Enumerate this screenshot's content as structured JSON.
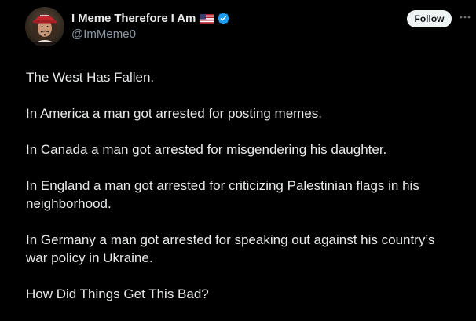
{
  "author": {
    "display_name": "I Meme Therefore I Am",
    "handle": "@ImMeme0",
    "flag_icon": "us-flag-icon",
    "verified_icon": "verified-badge-icon",
    "verified_color": "#1d9bf0"
  },
  "actions": {
    "follow_label": "Follow",
    "more_icon": "more-horizontal-icon"
  },
  "post": {
    "paragraphs": [
      "The West Has Fallen.",
      "In America a man got arrested for posting memes.",
      "In Canada a man got arrested for misgendering his daughter.",
      "In England a man got arrested for criticizing Palestinian flags in his neighborhood.",
      "In Germany a man got arrested for speaking out against his country’s war policy in Ukraine.",
      "How Did Things Get This Bad?"
    ]
  },
  "colors": {
    "background": "#000000",
    "text": "#e7e9ea",
    "secondary_text": "#8b98a5",
    "button_bg": "#eff3f4"
  }
}
